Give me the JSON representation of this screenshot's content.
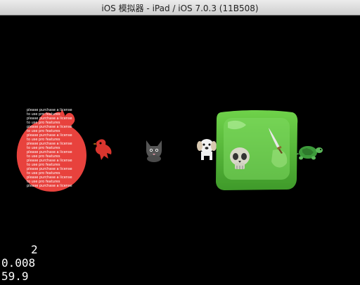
{
  "window": {
    "title": "iOS 模拟器 - iPad / iOS 7.0.3 (11B508)"
  },
  "scene": {
    "background": "#000000",
    "sprites": [
      {
        "name": "red-watermark-blob",
        "icon": "blob-sprite",
        "color": "#e8423d"
      },
      {
        "name": "red-bird",
        "icon": "bird-icon",
        "color": "#d9352e"
      },
      {
        "name": "gray-cat",
        "icon": "cat-icon",
        "color": "#555555"
      },
      {
        "name": "white-dog",
        "icon": "dog-icon",
        "color": "#f2f2f2"
      },
      {
        "name": "green-slime-cube",
        "icon": "slime-block",
        "color": "#5cbf3a"
      },
      {
        "name": "skull",
        "icon": "skull-icon",
        "color": "#d8d8c8"
      },
      {
        "name": "sword",
        "icon": "sword-icon",
        "color": "#e8e8e8"
      },
      {
        "name": "turtle",
        "icon": "turtle-icon",
        "color": "#3c9a3a"
      }
    ],
    "watermark": {
      "line_a": "please purchase a license",
      "line_b": "to use pro features"
    }
  },
  "debug": {
    "node_count": "2",
    "frame_time": "0.008",
    "fps": "59.9"
  }
}
